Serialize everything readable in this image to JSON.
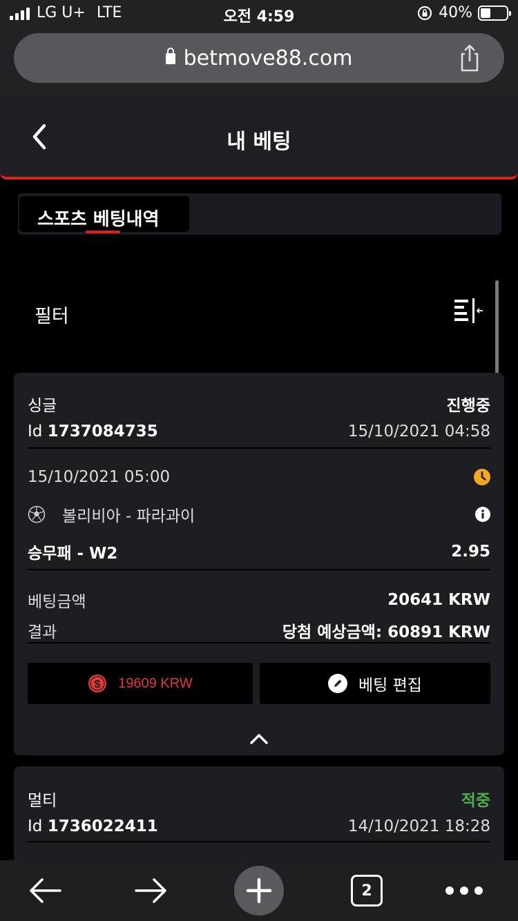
{
  "status_bar": {
    "carrier": "LG U+",
    "network": "LTE",
    "time": "오전 4:59",
    "battery_percent": "40%",
    "battery_level": 0.4
  },
  "browser": {
    "url": "betmove88.com",
    "tabs_count": "2"
  },
  "header": {
    "title": "내 베팅"
  },
  "tabs": {
    "active_label": "스포츠 베팅내역"
  },
  "filter": {
    "label": "필터"
  },
  "bets": [
    {
      "type": "싱글",
      "status": "진행중",
      "id_label": "Id",
      "id": "1737084735",
      "placed_at": "15/10/2021 04:58",
      "event_time": "15/10/2021 05:00",
      "match": "볼리비아 - 파라과이",
      "market": "승무패 - W2",
      "odds": "2.95",
      "stake_label": "베팅금액",
      "stake": "20641 KRW",
      "result_label": "결과",
      "potential_win": "당첨 예상금액: 60891 KRW",
      "cashout": "19609  KRW",
      "edit_label": "베팅 편집"
    },
    {
      "type": "멀티",
      "status": "적중",
      "id_label": "Id",
      "id": "1736022411",
      "placed_at": "14/10/2021 18:28"
    }
  ],
  "colors": {
    "accent": "#d7261e",
    "win": "#4caf50",
    "pending": "#f5a623"
  }
}
